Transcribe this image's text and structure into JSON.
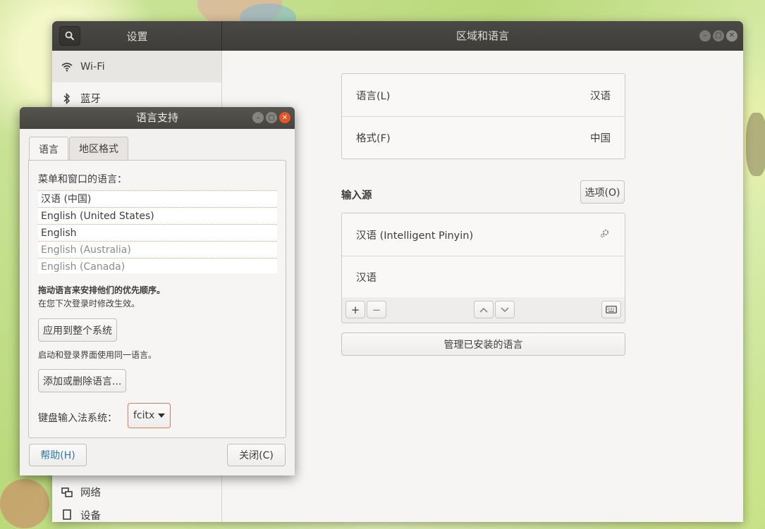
{
  "settings": {
    "sidebar_title": "设置",
    "window_title": "区域和语言",
    "sidebar": {
      "items": [
        {
          "label": "Wi-Fi",
          "icon": "wifi-icon"
        },
        {
          "label": "蓝牙",
          "icon": "bluetooth-icon"
        },
        {
          "label": "网络",
          "icon": "network-icon"
        },
        {
          "label": "设备",
          "icon": "devices-icon"
        }
      ]
    },
    "language_rows": [
      {
        "label": "语言(L)",
        "value": "汉语"
      },
      {
        "label": "格式(F)",
        "value": "中国"
      }
    ],
    "input_sources": {
      "title": "输入源",
      "options_label": "选项(O)",
      "items": [
        {
          "label": "汉语 (Intelligent Pinyin)",
          "icon": "gear-icon"
        },
        {
          "label": "汉语"
        }
      ],
      "toolbar": {
        "add": "+",
        "remove": "−"
      }
    },
    "manage_label": "管理已安装的语言"
  },
  "dialog": {
    "title": "语言支持",
    "tabs": [
      {
        "label": "语言"
      },
      {
        "label": "地区格式"
      }
    ],
    "list_label": "菜单和窗口的语言：",
    "languages": [
      "汉语 (中国)",
      "English (United States)",
      "English",
      "English (Australia)",
      "English (Canada)"
    ],
    "drag_hint": "拖动语言来安排他们的优先顺序。",
    "effect_hint": "在您下次登录时修改生效。",
    "apply_label": "应用到整个系统",
    "login_hint": "启动和登录界面使用同一语言。",
    "add_remove_label": "添加或删除语言...",
    "keyboard_label": "键盘输入法系统：",
    "keyboard_value": "fcitx",
    "help_label": "帮助(H)",
    "close_label": "关闭(C)"
  },
  "colors": {
    "accent": "#e95420",
    "titlebar": "#3e3d39",
    "help_text": "#2a79b3"
  }
}
